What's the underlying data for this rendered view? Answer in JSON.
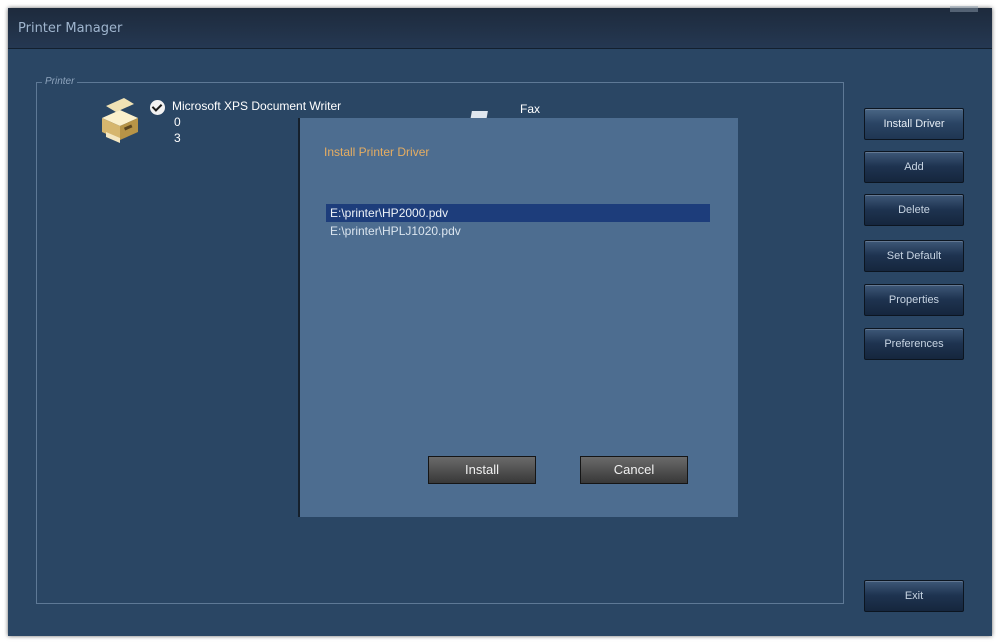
{
  "window": {
    "title": "Printer Manager"
  },
  "group": {
    "label": "Printer"
  },
  "printers": [
    {
      "name": "Microsoft XPS Document Writer",
      "jobs": "0",
      "status": "3",
      "default": true,
      "icon": "printer-icon"
    },
    {
      "name": "Fax",
      "icon": "fax-icon"
    }
  ],
  "sidebar": {
    "buttons": [
      "Install Driver",
      "Add",
      "Delete",
      "Set Default",
      "Properties",
      "Preferences"
    ],
    "exit_label": "Exit"
  },
  "dialog": {
    "title": "Install Printer Driver",
    "items": [
      "E:\\printer\\HP2000.pdv",
      "E:\\printer\\HPLJ1020.pdv"
    ],
    "selected_index": 0,
    "install_label": "Install",
    "cancel_label": "Cancel"
  },
  "colors": {
    "window_bg": "#2a4664",
    "dialog_bg": "#4d6d90",
    "dialog_title": "#e5ad62",
    "selection": "#1d3d7b"
  }
}
